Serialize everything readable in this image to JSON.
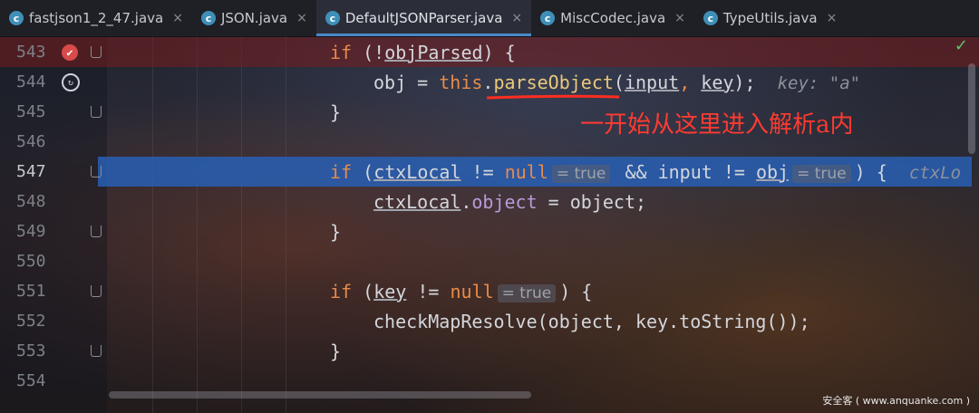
{
  "tabs": [
    {
      "icon": "c",
      "label": "fastjson1_2_47.java",
      "active": false
    },
    {
      "icon": "c",
      "label": "JSON.java",
      "active": false
    },
    {
      "icon": "c",
      "label": "DefaultJSONParser.java",
      "active": true
    },
    {
      "icon": "c",
      "label": "MiscCodec.java",
      "active": false
    },
    {
      "icon": "c",
      "label": "TypeUtils.java",
      "active": false
    }
  ],
  "tab_close_glyph": "×",
  "lines": [
    {
      "num": "543"
    },
    {
      "num": "544"
    },
    {
      "num": "545"
    },
    {
      "num": "546"
    },
    {
      "num": "547"
    },
    {
      "num": "548"
    },
    {
      "num": "549"
    },
    {
      "num": "550"
    },
    {
      "num": "551"
    },
    {
      "num": "552"
    },
    {
      "num": "553"
    },
    {
      "num": "554"
    }
  ],
  "code": {
    "l543_kw": "if",
    "l543_rest": " (!",
    "l543_var": "objParsed",
    "l543_end": ") {",
    "l544_a": "obj = ",
    "l544_this": "this",
    "l544_dot": ".",
    "l544_fn": "parseObject",
    "l544_open": "(",
    "l544_arg1": "input",
    "l544_comma": ", ",
    "l544_arg2": "key",
    "l544_close": ");",
    "l544_hint": "key: \"a\"",
    "l545": "}",
    "l547_kw": "if",
    "l547_open": " (",
    "l547_var": "ctxLocal",
    "l547_neq": " != ",
    "l547_null": "null",
    "l547_hint1": "= true",
    "l547_and": " && input != ",
    "l547_obj": "obj",
    "l547_hint2": "= true",
    "l547_end": ") {",
    "l547_inlay": "ctxLo",
    "l548_var": "ctxLocal",
    "l548_dot": ".",
    "l548_fld": "object",
    "l548_rest": " = object;",
    "l549": "}",
    "l551_kw": "if",
    "l551_open": " (",
    "l551_var": "key",
    "l551_neq": " != ",
    "l551_null": "null",
    "l551_hint": "= true",
    "l551_end": ") {",
    "l552": "checkMapResolve(object, key.toString());",
    "l553": "}"
  },
  "annotation": "一开始从这里进入解析a内",
  "watermark": "安全客 ( www.anquanke.com )",
  "check_glyph": "✓",
  "colors": {
    "accent": "#4a88c7",
    "keyword": "#e88b4a",
    "annotation": "#ff3b30",
    "selection": "#2a5fb4",
    "breakpoint": "#d94a4a"
  }
}
